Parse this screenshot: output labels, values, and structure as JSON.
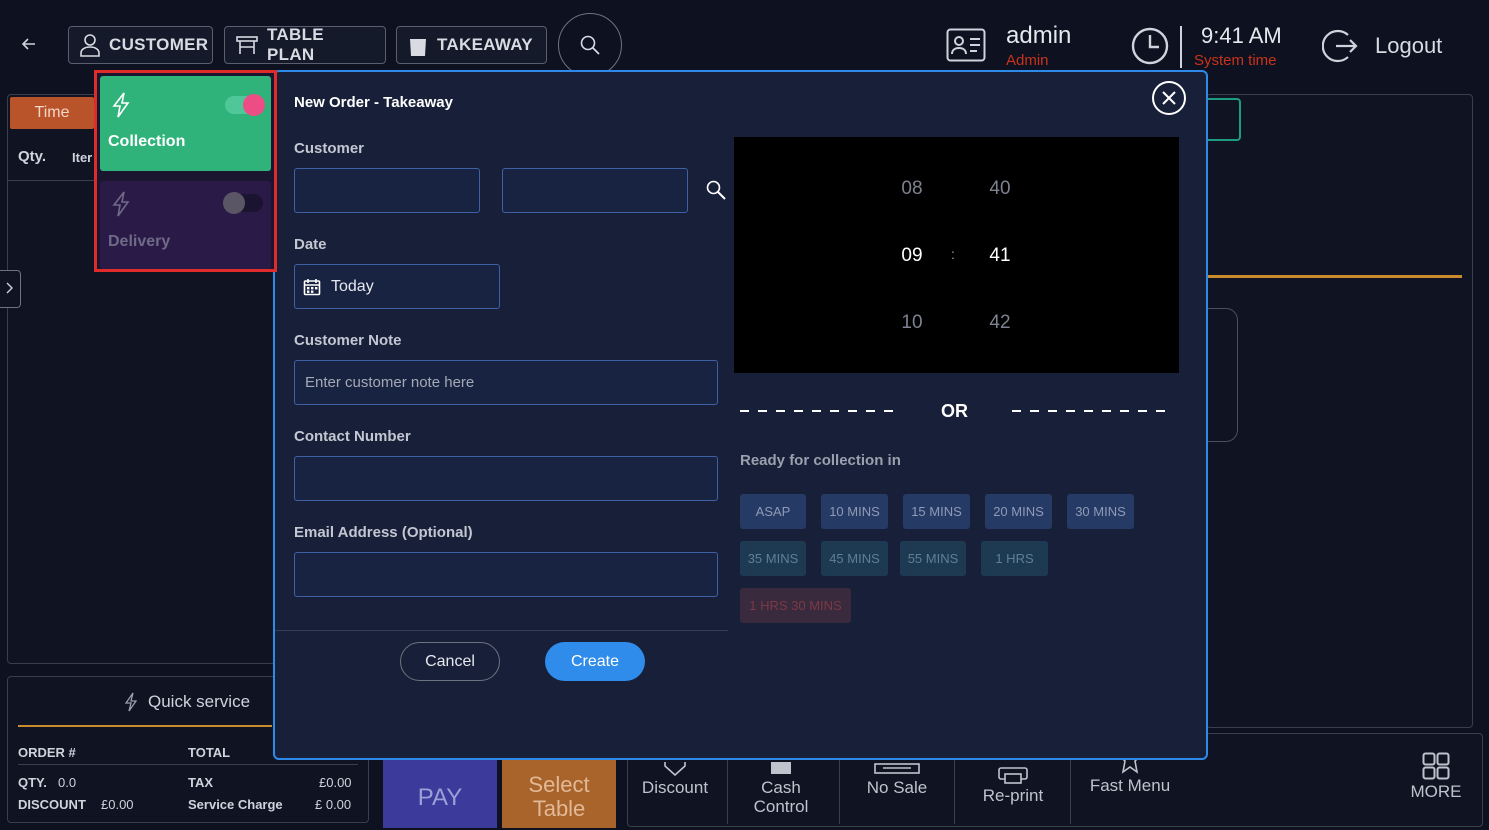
{
  "topbar": {
    "nav": {
      "customer": "CUSTOMER",
      "table_plan": "TABLE PLAN",
      "takeaway": "TAKEAWAY"
    },
    "user": {
      "name": "admin",
      "role": "Admin"
    },
    "clock": {
      "time": "9:41 AM",
      "label": "System time"
    },
    "logout": "Logout"
  },
  "left_panel": {
    "time_tab": "Time",
    "col_qty": "Qty.",
    "col_item": "Iter"
  },
  "summary": {
    "quick_service": "Quick service",
    "order_label": "ORDER #",
    "total_label": "TOTAL",
    "qty_label": "QTY.",
    "qty_value": "0.0",
    "tax_label": "TAX",
    "tax_value": "£0.00",
    "discount_label": "DISCOUNT",
    "discount_value": "£0.00",
    "service_label": "Service Charge",
    "service_value": "£ 0.00"
  },
  "actions": {
    "pay": "PAY",
    "select_table_1": "Select",
    "select_table_2": "Table",
    "discount": "Discount",
    "cash_control_1": "Cash",
    "cash_control_2": "Control",
    "no_sale": "No Sale",
    "reprint": "Re-print",
    "fast_menu": "Fast Menu",
    "more": "MORE"
  },
  "order_types": [
    {
      "label": "Collection",
      "enabled": true
    },
    {
      "label": "Delivery",
      "enabled": false
    }
  ],
  "modal": {
    "title": "New Order - Takeaway",
    "customer_label": "Customer",
    "customer_first": "",
    "customer_last": "",
    "date_label": "Date",
    "date_value": "Today",
    "note_label": "Customer Note",
    "note_placeholder": "Enter customer note here",
    "contact_label": "Contact Number",
    "contact_value": "",
    "email_label": "Email Address (Optional)",
    "email_value": "",
    "cancel": "Cancel",
    "create": "Create",
    "time_picker": {
      "hours": [
        "08",
        "09",
        "10"
      ],
      "minutes": [
        "40",
        "41",
        "42"
      ],
      "separator": ":"
    },
    "or": "OR",
    "ready_label": "Ready for collection in",
    "ready_options": [
      "ASAP",
      "10 MINS",
      "15 MINS",
      "20 MINS",
      "30 MINS",
      "35 MINS",
      "45 MINS",
      "55 MINS",
      "1 HRS",
      "1 HRS 30 MINS"
    ]
  },
  "colors": {
    "accent_blue": "#2f8cea",
    "collection_green": "#2fb37a",
    "toggle_pink": "#ec4d84",
    "alert_red": "#c9331b",
    "highlight_red": "#e02b2b"
  }
}
